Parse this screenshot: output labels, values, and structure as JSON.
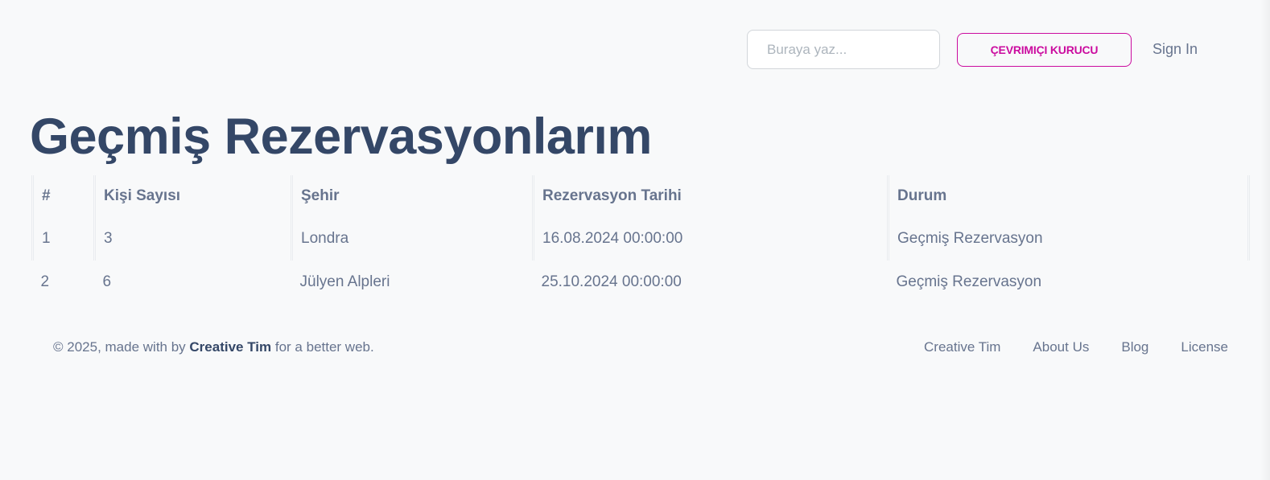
{
  "navbar": {
    "search_placeholder": "Buraya yaz...",
    "online_button": "ÇEVRIMIÇI KURUCU",
    "signin": "Sign In"
  },
  "page_title": "Geçmiş Rezervasyonlarım",
  "table": {
    "headers": {
      "index": "#",
      "kisi": "Kişi Sayısı",
      "sehir": "Şehir",
      "tarih": "Rezervasyon Tarihi",
      "durum": "Durum"
    },
    "rows": [
      {
        "index": "1",
        "kisi": "3",
        "sehir": "Londra",
        "tarih": "16.08.2024 00:00:00",
        "durum": "Geçmiş Rezervasyon"
      },
      {
        "index": "2",
        "kisi": "6",
        "sehir": "Jülyen Alpleri",
        "tarih": "25.10.2024 00:00:00",
        "durum": "Geçmiş Rezervasyon"
      }
    ]
  },
  "footer": {
    "copyright_prefix": "© 2025, made with by",
    "brand": "Creative Tim",
    "copyright_suffix": "for a better web.",
    "links": [
      "Creative Tim",
      "About Us",
      "Blog",
      "License"
    ]
  },
  "colors": {
    "accent": "#cb0c9f",
    "heading": "#344767",
    "text": "#67748e",
    "background": "#f8f9fa"
  }
}
